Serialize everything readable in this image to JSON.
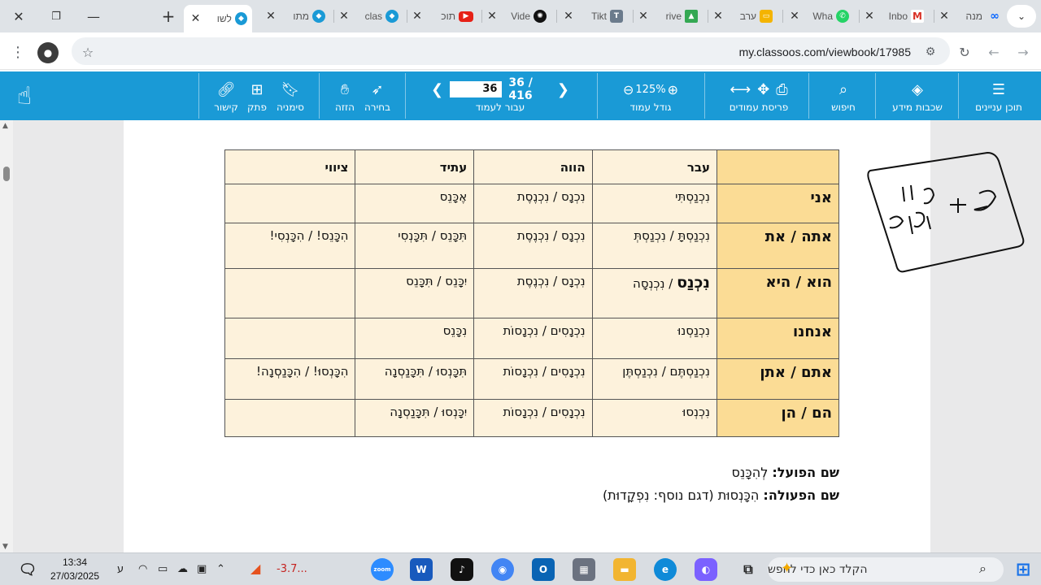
{
  "browser": {
    "tabs": [
      {
        "title": "מנה",
        "icon": "meta-icon"
      },
      {
        "title": "Inbo",
        "icon": "gmail-icon"
      },
      {
        "title": "Wha",
        "icon": "whatsapp-icon"
      },
      {
        "title": "ערב",
        "icon": "slides-icon"
      },
      {
        "title": "rive",
        "icon": "drive-icon"
      },
      {
        "title": "Tikt",
        "icon": "tiktok-icon"
      },
      {
        "title": "Vide",
        "icon": "openai-icon"
      },
      {
        "title": "תוכ",
        "icon": "youtube-icon"
      },
      {
        "title": "clas",
        "icon": "classoos-icon"
      },
      {
        "title": "מתו",
        "icon": "classoos-icon"
      },
      {
        "title": "לשו",
        "icon": "classoos-icon",
        "active": true
      }
    ],
    "url": "my.classoos.com/viewbook/17985"
  },
  "toolbar": {
    "menu_label": "תוכן עניינים",
    "layers_label": "שכבות מידע",
    "search_label": "חיפוש",
    "spread_label": "פריסת עמודים",
    "zoom_label": "גודל עמוד",
    "zoom_value": "125%",
    "goto_label": "עבור לעמוד",
    "page_input": "36",
    "page_count": "36 / 416",
    "select_label": "בחירה",
    "move_label": "הזזה",
    "bookmark_label": "סימניה",
    "note_label": "פתק",
    "link_label": "קישור"
  },
  "table": {
    "headers": [
      "",
      "עבר",
      "הווה",
      "עתיד",
      "ציווי"
    ],
    "rows": [
      {
        "pronoun": "אני",
        "past": "נִכְנַסְתִּי",
        "present": "נִכְנָס / נִכְנֶסֶת",
        "future": "אֶכָּנֵס",
        "imperative": ""
      },
      {
        "pronoun": "אתה / את",
        "past": "נִכְנַסְתָּ / נִכְנַסְתְּ",
        "present": "נִכְנָס / נִכְנֶסֶת",
        "future": "תִּכָּנֵס / תִּכָּנְסִי",
        "imperative": "הִכָּנֵס! / הִכָּנְסִי!"
      },
      {
        "pronoun": "הוא / היא",
        "past_bold": "נִכְנַס",
        "past_rest": " / נִכְנְסָה",
        "present": "נִכְנָס / נִכְנֶסֶת",
        "future": "יִכָּנֵס / תִּכָּנֵס",
        "imperative": ""
      },
      {
        "pronoun": "אנחנו",
        "past": "נִכְנַסְנוּ",
        "present": "נִכְנָסִים / נִכְנָסוֹת",
        "future": "נִכָּנֵס",
        "imperative": ""
      },
      {
        "pronoun": "אתם / אתן",
        "past": "נִכְנַסְתֶּם / נִכְנַסְתֶּן",
        "present": "נִכְנָסִים / נִכְנָסוֹת",
        "future": "תִּכָּנְסוּ / תִּכָּנַסְנָה",
        "imperative": "הִכָּנְסוּ! / הִכָּנַסְנָה!"
      },
      {
        "pronoun": "הם / הן",
        "past": "נִכְנְסוּ",
        "present": "נִכְנָסִים / נִכְנָסוֹת",
        "future": "יִכָּנְסוּ / תִּכָּנַסְנָה",
        "imperative": ""
      }
    ]
  },
  "infinitive": {
    "label": "שם הפועל:",
    "value": " לְהִכָּנֵס"
  },
  "verbal_noun": {
    "label": "שם הפעולה:",
    "value": " הִכָּנְסוּת (דגם נוסף: נִפְקָדוּת)"
  },
  "taskbar": {
    "search_placeholder": "הקלד כאן כדי לחפש",
    "time": "13:34",
    "date": "27/03/2025",
    "lang": "ע",
    "stock": "-3.7...",
    "zoom_app": "zoom",
    "word_app": "W"
  }
}
